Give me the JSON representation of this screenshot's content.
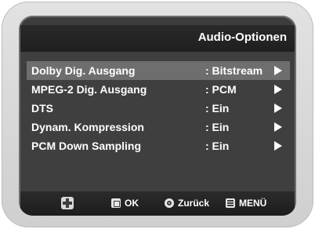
{
  "header": {
    "title": "Audio-Optionen"
  },
  "menu": {
    "items": [
      {
        "label": "Dolby Dig. Ausgang",
        "value": ": Bitstream",
        "selected": true
      },
      {
        "label": "MPEG-2 Dig. Ausgang",
        "value": ": PCM",
        "selected": false
      },
      {
        "label": "DTS",
        "value": ": Ein",
        "selected": false
      },
      {
        "label": "Dynam. Kompression",
        "value": ": Ein",
        "selected": false
      },
      {
        "label": "PCM Down Sampling",
        "value": ": Ein",
        "selected": false
      }
    ]
  },
  "footer": {
    "nav_icon": "dpad-icon",
    "ok_label": "OK",
    "back_label": "Zurück",
    "menu_label": "MENÜ"
  },
  "colors": {
    "screen_bg": "#3f3f3f",
    "selected_row": "#6e6e6e",
    "header_bg": "#222222",
    "text": "#ffffff"
  }
}
